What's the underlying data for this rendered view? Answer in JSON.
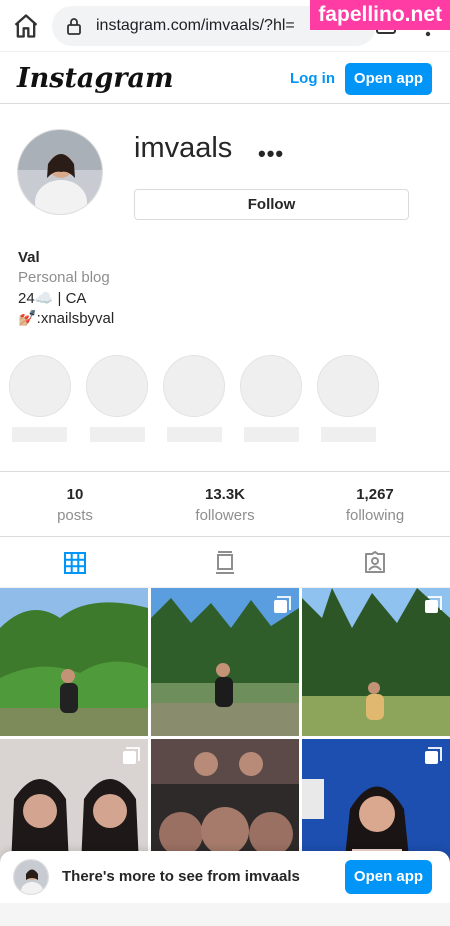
{
  "browser": {
    "url": "instagram.com/imvaals/?hl=",
    "watermark": "fapellino.net"
  },
  "header": {
    "logo": "Instagram",
    "login_label": "Log in",
    "open_app_label": "Open app"
  },
  "profile": {
    "username": "imvaals",
    "more": "•••",
    "follow_label": "Follow",
    "bio": {
      "name": "Val",
      "category": "Personal blog",
      "line1": "24☁️ | CA",
      "line2": "💅🏼:xnailsbyval"
    }
  },
  "stats": [
    {
      "num": "10",
      "label": "posts"
    },
    {
      "num": "13.3K",
      "label": "followers"
    },
    {
      "num": "1,267",
      "label": "following"
    }
  ],
  "tabs": [
    "grid-icon",
    "feed-icon",
    "tagged-icon"
  ],
  "colors": {
    "accent": "#0095f6",
    "text": "#262626",
    "muted": "#8e8e8e",
    "border": "#dbdbdb"
  },
  "banner": {
    "text": "There's more to see from imvaals",
    "button_label": "Open app"
  }
}
